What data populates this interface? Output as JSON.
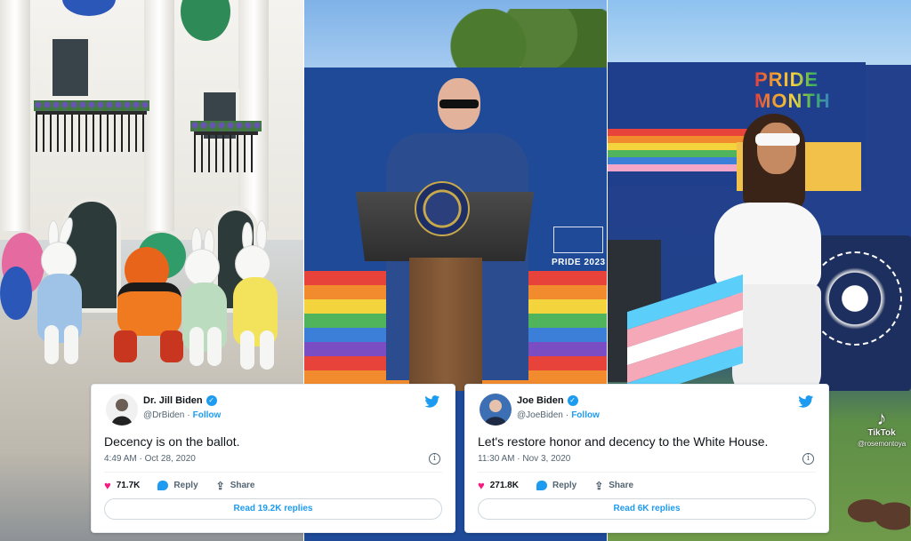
{
  "tweets": {
    "left": {
      "name": "Dr. Jill Biden",
      "handle": "@DrBiden",
      "separator": "·",
      "follow": "Follow",
      "text": "Decency is on the ballot.",
      "timestamp": "4:49 AM · Oct 28, 2020",
      "likes": "71.7K",
      "reply_label": "Reply",
      "share_label": "Share",
      "read_replies": "Read 19.2K replies"
    },
    "right": {
      "name": "Joe Biden",
      "handle": "@JoeBiden",
      "separator": "·",
      "follow": "Follow",
      "text": "Let's restore honor and decency to the White House.",
      "timestamp": "11:30 AM · Nov 3, 2020",
      "likes": "271.8K",
      "reply_label": "Reply",
      "share_label": "Share",
      "read_replies": "Read 6K replies"
    }
  },
  "scene": {
    "pride_sign": "PRIDE MONTH",
    "pride_year": "PRIDE 2023",
    "tiktok_name": "TikTok",
    "tiktok_handle": "@rosemontoya"
  },
  "colors": {
    "twitter_blue": "#1d9bf0",
    "like_pink": "#f91880"
  },
  "icons": {
    "bird": "twitter-bird-icon",
    "verified": "verified-badge-icon",
    "heart": "heart-icon",
    "reply": "reply-bubble-icon",
    "share": "share-icon",
    "info": "info-icon"
  }
}
